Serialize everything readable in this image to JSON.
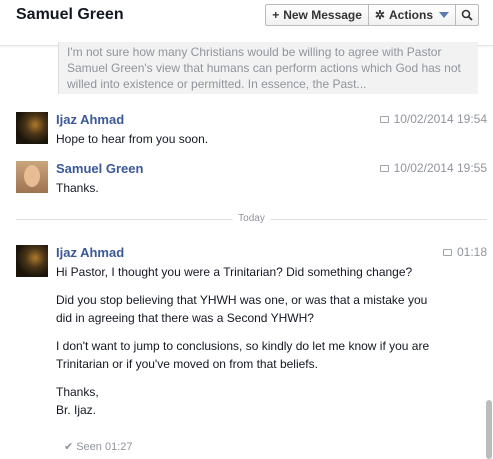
{
  "header": {
    "title": "Samuel Green",
    "new_message_label": "New Message",
    "actions_label": "Actions"
  },
  "quoted_preview": {
    "text": "I'm not sure how many Christians would be willing to agree with Pastor Samuel Green's view that humans can perform actions which God has not willed into existence or permitted. In essence, the Past..."
  },
  "messages": [
    {
      "sender": "Ijaz Ahmad",
      "time": "10/02/2014 19:54",
      "paragraphs": [
        "Hope to hear from you soon."
      ]
    },
    {
      "sender": "Samuel Green",
      "time": "10/02/2014 19:55",
      "paragraphs": [
        "Thanks."
      ]
    },
    {
      "sender": "Ijaz Ahmad",
      "time": "01:18",
      "paragraphs": [
        "Hi Pastor, I thought you were a Trinitarian? Did something change?",
        "Did you stop believing that YHWH was one, or was that a mistake you did in agreeing that there was a Second YHWH?",
        "I don't want to jump to conclusions, so kindly do let me know if you are Trinitarian or if you've moved on from that beliefs.",
        "Thanks,",
        "Br. Ijaz."
      ]
    }
  ],
  "divider": {
    "label": "Today"
  },
  "seen": {
    "label": "Seen 01:27"
  },
  "icons": {
    "new_message": "plus-icon",
    "actions": "gear-icon",
    "search": "search-icon",
    "timestamp": "chat-bubble-icon",
    "seen": "checkmark-icon"
  },
  "colors": {
    "sender_name": "#3b5998",
    "muted_text": "#90949c",
    "caret": "#5b7bb0"
  }
}
